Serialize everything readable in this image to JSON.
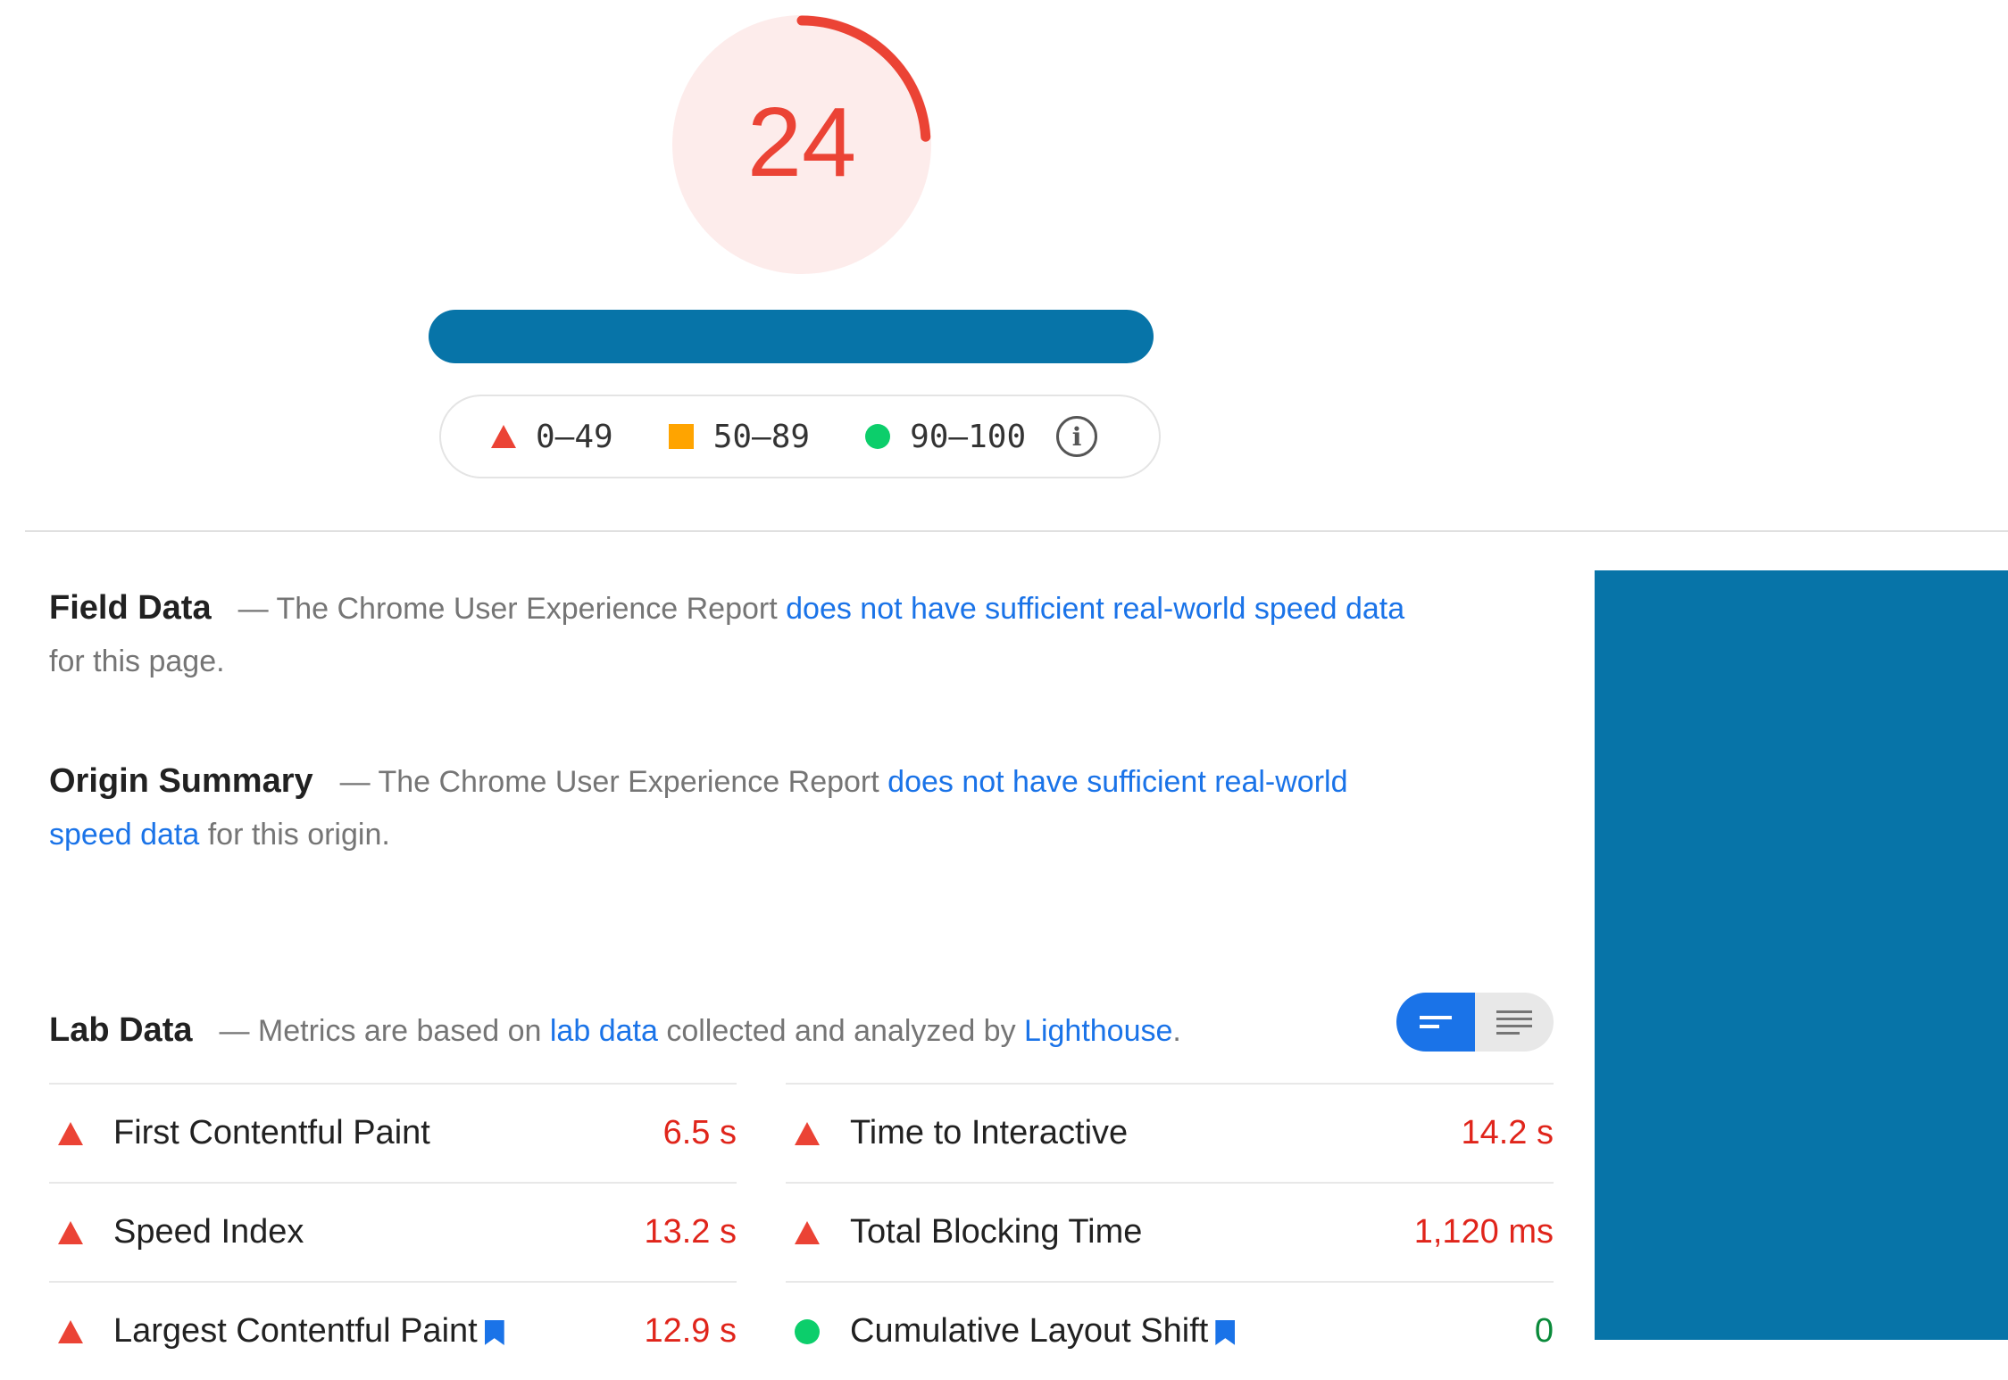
{
  "score": {
    "value": "24",
    "fraction": 0.24,
    "color": "#eb4335"
  },
  "legend": {
    "items": [
      {
        "icon": "red-triangle-icon",
        "label": "0–49"
      },
      {
        "icon": "orange-square-icon",
        "label": "50–89"
      },
      {
        "icon": "green-circle-icon",
        "label": "90–100"
      }
    ],
    "info_icon": "info-icon"
  },
  "field_data": {
    "heading": "Field Data",
    "prefix": "— The Chrome User Experience Report ",
    "link": "does not have sufficient real-world speed data",
    "suffix": " for this page."
  },
  "origin_summary": {
    "heading": "Origin Summary",
    "prefix": "— The Chrome User Experience Report ",
    "link": "does not have sufficient real-world speed data",
    "suffix": " for this origin."
  },
  "lab_data": {
    "heading": "Lab Data",
    "prefix": "— Metrics are based on ",
    "link1": "lab data",
    "middle": " collected and analyzed by ",
    "link2": "Lighthouse",
    "suffix": "."
  },
  "toggle": {
    "left_icon": "compact-view-icon",
    "right_icon": "expanded-view-icon",
    "active": "left"
  },
  "metrics_left": [
    {
      "label": "First Contentful Paint",
      "value": "6.5 s",
      "status": "fail"
    },
    {
      "label": "Speed Index",
      "value": "13.2 s",
      "status": "fail"
    },
    {
      "label": "Largest Contentful Paint",
      "value": "12.9 s",
      "status": "fail",
      "bookmark": true
    }
  ],
  "metrics_right": [
    {
      "label": "Time to Interactive",
      "value": "14.2 s",
      "status": "fail"
    },
    {
      "label": "Total Blocking Time",
      "value": "1,120 ms",
      "status": "fail"
    },
    {
      "label": "Cumulative Layout Shift",
      "value": "0",
      "status": "pass",
      "bookmark": true
    }
  ],
  "colors": {
    "fail": "#eb4335",
    "average": "#ffa400",
    "pass": "#0cce6b",
    "link": "#1a73e8",
    "redaction": "#0774a8"
  }
}
